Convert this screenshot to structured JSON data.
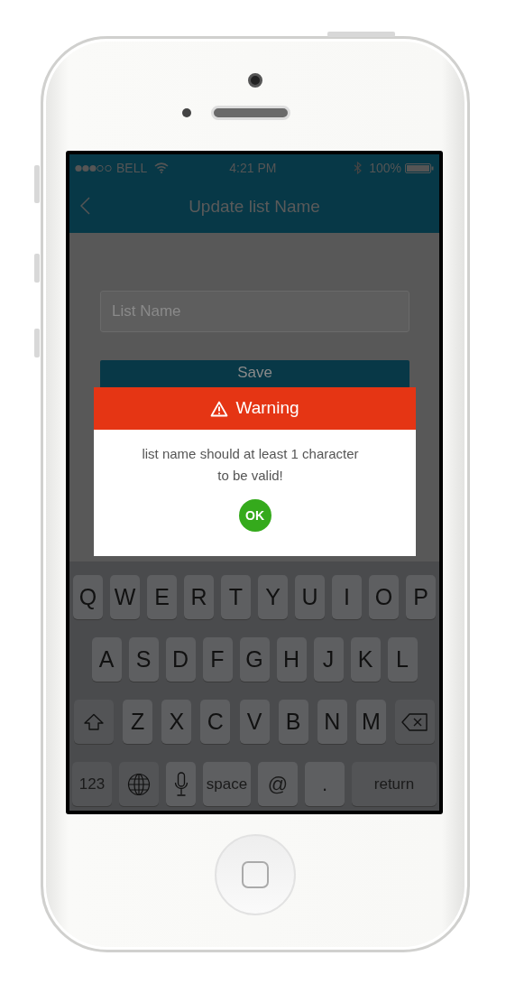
{
  "status_bar": {
    "carrier": "BELL",
    "time": "4:21 PM",
    "battery": "100%"
  },
  "nav_bar": {
    "title": "Update list Name"
  },
  "form": {
    "field": {
      "placeholder": "List Name"
    },
    "save_button": "Save"
  },
  "dialog": {
    "title": "Warning",
    "message_lines": [
      "list name should at least 1 character",
      "to be valid!"
    ],
    "ok_button": "OK"
  },
  "keyboard": {
    "row_1": [
      {
        "kind": "letter",
        "label": "Q"
      },
      {
        "kind": "letter",
        "label": "W"
      },
      {
        "kind": "letter",
        "label": "E"
      },
      {
        "kind": "letter",
        "label": "R"
      },
      {
        "kind": "letter",
        "label": "T"
      },
      {
        "kind": "letter",
        "label": "Y"
      },
      {
        "kind": "letter",
        "label": "U"
      },
      {
        "kind": "letter",
        "label": "I"
      },
      {
        "kind": "letter",
        "label": "O"
      },
      {
        "kind": "letter",
        "label": "P"
      }
    ],
    "row_2": [
      {
        "kind": "letter",
        "label": "A"
      },
      {
        "kind": "letter",
        "label": "S"
      },
      {
        "kind": "letter",
        "label": "D"
      },
      {
        "kind": "letter",
        "label": "F"
      },
      {
        "kind": "letter",
        "label": "G"
      },
      {
        "kind": "letter",
        "label": "H"
      },
      {
        "kind": "letter",
        "label": "J"
      },
      {
        "kind": "letter",
        "label": "K"
      },
      {
        "kind": "letter",
        "label": "L"
      }
    ],
    "row_3": [
      {
        "kind": "shift"
      },
      {
        "kind": "letter",
        "label": "Z"
      },
      {
        "kind": "letter",
        "label": "X"
      },
      {
        "kind": "letter",
        "label": "C"
      },
      {
        "kind": "letter",
        "label": "V"
      },
      {
        "kind": "letter",
        "label": "B"
      },
      {
        "kind": "letter",
        "label": "N"
      },
      {
        "kind": "letter",
        "label": "M"
      },
      {
        "kind": "backspace"
      }
    ],
    "row_4": [
      {
        "kind": "numbers",
        "label": "123"
      },
      {
        "kind": "globe"
      },
      {
        "kind": "mic"
      },
      {
        "kind": "space",
        "label": "space"
      },
      {
        "kind": "symbol",
        "label": "@"
      },
      {
        "kind": "symbol",
        "label": "."
      },
      {
        "kind": "return",
        "label": "return"
      }
    ]
  }
}
